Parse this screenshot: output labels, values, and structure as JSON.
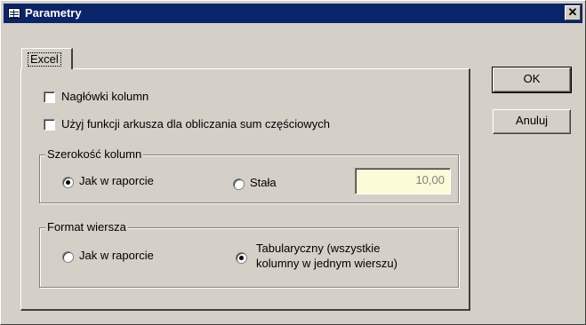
{
  "window": {
    "title": "Parametry",
    "title_icon": "table-icon",
    "close_glyph": "✕"
  },
  "tabs": [
    {
      "label": "Excel"
    }
  ],
  "options": {
    "headers": {
      "label": "Nagłówki kolumn",
      "checked": false
    },
    "subtotals": {
      "label": "Użyj funkcji arkusza dla obliczania sum częściowych",
      "checked": false
    }
  },
  "column_width": {
    "legend": "Szerokość kolumn",
    "option_report": "Jak w raporcie",
    "option_fixed": "Stała",
    "selected": "report",
    "value": "10,00"
  },
  "row_format": {
    "legend": "Format wiersza",
    "option_report": "Jak w raporcie",
    "option_tabular_line1": "Tabularyczny (wszystkie",
    "option_tabular_line2": "kolumny w jednym wierszu)",
    "selected": "tabular"
  },
  "buttons": {
    "ok": "OK",
    "cancel": "Anuluj"
  }
}
